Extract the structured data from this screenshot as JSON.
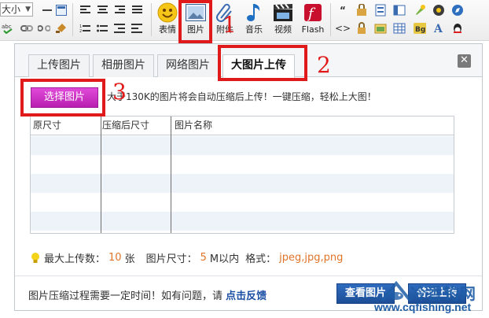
{
  "toolbar": {
    "font_size_label": "大小",
    "buttons": [
      {
        "label": "表情",
        "icon": "smiley-icon"
      },
      {
        "label": "图片",
        "icon": "image-icon"
      },
      {
        "label": "附件",
        "icon": "paperclip-icon"
      },
      {
        "label": "音乐",
        "icon": "music-note-icon"
      },
      {
        "label": "视频",
        "icon": "video-clapper-icon"
      },
      {
        "label": "Flash",
        "icon": "flash-icon"
      }
    ]
  },
  "dialog": {
    "tabs": [
      {
        "label": "上传图片",
        "active": false
      },
      {
        "label": "相册图片",
        "active": false
      },
      {
        "label": "网络图片",
        "active": false
      },
      {
        "label": "大图片上传",
        "active": true
      }
    ],
    "choose_button": "选择图片",
    "hint": "大于130K的图片将会自动压缩后上传！一键压缩，轻松上大图！",
    "table": {
      "columns": [
        "原尺寸",
        "压缩后尺寸",
        "图片名称"
      ],
      "empty_rows": 5
    },
    "limits": {
      "max_label": "最大上传数：",
      "max_value": "10",
      "max_unit": "张",
      "size_label": "图片尺寸：",
      "size_value": "5",
      "size_unit": "M以内",
      "format_label": "格式：",
      "format_value": "jpeg,jpg,png"
    },
    "footer": {
      "text": "图片压缩过程需要一定时间！如有问题，请",
      "link": "点击反馈",
      "view_button": "查看图片",
      "upload_button": "普通上传"
    }
  },
  "annotations": [
    "1",
    "2",
    "3"
  ],
  "watermark": {
    "title": "冷香钓网",
    "url": "www.cqfishing.net"
  },
  "colors": {
    "annotation_red": "#e01a1a",
    "choose_button": "#cc2ec6",
    "limit_values": "#e0742a",
    "feedback_link": "#1b4fa3",
    "footer_buttons": "#2360ad"
  }
}
